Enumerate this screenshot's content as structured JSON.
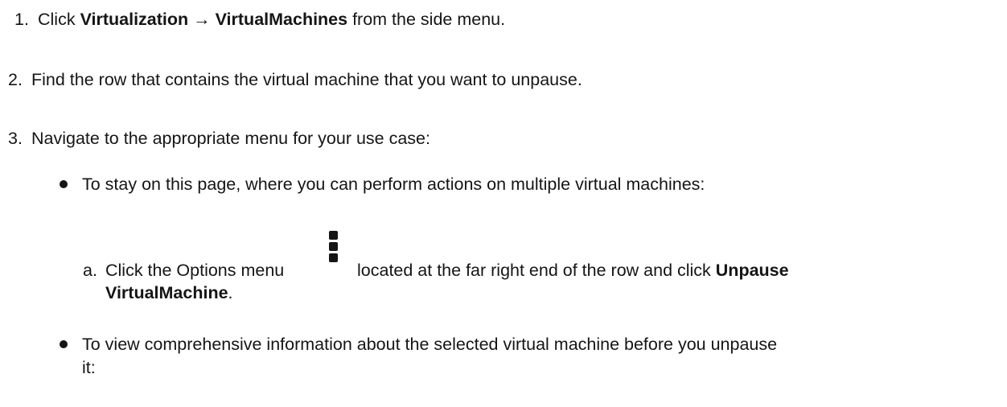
{
  "steps": [
    {
      "number": "1.",
      "prefix": "Click ",
      "bold": "Virtualization → VirtualMachines",
      "suffix": " from the side menu."
    },
    {
      "number": "2.",
      "text": "Find the row that contains the virtual machine that you want to unpause."
    },
    {
      "number": "3.",
      "text": "Navigate to the appropriate menu for your use case:"
    }
  ],
  "bullets": [
    {
      "text": "To stay on this page, where you can perform actions on multiple virtual machines:"
    },
    {
      "line1": "To view comprehensive information about the selected virtual machine before you unpause",
      "line2": "it:"
    }
  ],
  "substep": {
    "letter": "a.",
    "prefix": "Click the Options menu",
    "icon": "kebab-icon",
    "middle": "located at the far right end of the row and click ",
    "bold_line1": "Unpause",
    "bold_line2": "VirtualMachine",
    "suffix": "."
  }
}
